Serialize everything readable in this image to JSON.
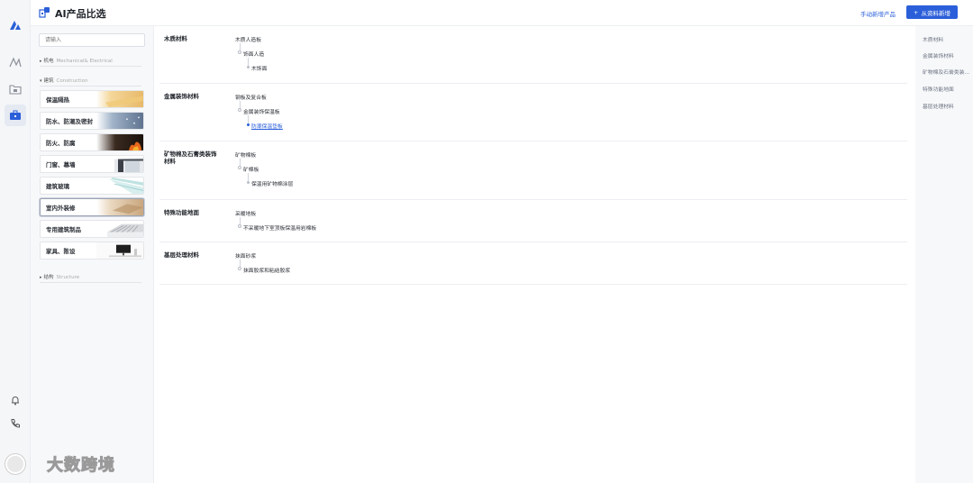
{
  "app": {
    "title": "AI产品比选"
  },
  "toolbar": {
    "manual_add": "手动新增产品",
    "add_from_data": "从资料新增",
    "add_plus": "+"
  },
  "rail": {
    "icons": [
      "logo-icon",
      "ai-icon",
      "folder-icon",
      "toolbox-icon",
      "bell-icon",
      "phone-icon"
    ]
  },
  "sidebar": {
    "search_placeholder": "请输入",
    "groups": [
      {
        "label": "机电",
        "en": "Mechanical& Electrical",
        "arrow": "▸"
      },
      {
        "label": "建筑",
        "en": "Construction",
        "arrow": "▾"
      },
      {
        "label": "结构",
        "en": "Structure",
        "arrow": "▸"
      }
    ],
    "cards": [
      {
        "label": "保温隔热"
      },
      {
        "label": "防水、防潮及密封"
      },
      {
        "label": "防火、防腐"
      },
      {
        "label": "门窗、幕墙"
      },
      {
        "label": "建筑玻璃"
      },
      {
        "label": "室内外装修",
        "active": true
      },
      {
        "label": "专用建筑制品"
      },
      {
        "label": "家具、陈设"
      }
    ]
  },
  "sections": [
    {
      "title": "木质材料",
      "l1": "木质人造板",
      "l2": [
        "饰面人造"
      ],
      "l3": [
        "木饰面"
      ]
    },
    {
      "title": "金属装饰材料",
      "l1": "钢板及复合板",
      "l2": [
        "金属装饰保温板"
      ],
      "l3": [
        "防潮保温垫板"
      ]
    },
    {
      "title": "矿物棉及石膏类装饰材料",
      "l1": "矿物棉板",
      "l2": [
        "矿棉板"
      ],
      "l3": [
        "保温用矿物棉涂层"
      ]
    },
    {
      "title": "特殊功能地面",
      "l1": "采暖地板",
      "l2": [
        "不采暖地下室顶板保温用岩棉板"
      ]
    },
    {
      "title": "基层处理材料",
      "l1": "抹面砂浆",
      "l2": [
        "抹面胶浆和粘结胶浆"
      ]
    }
  ],
  "anchors": [
    "木质材料",
    "金属装饰材料",
    "矿物棉及石膏类装饰材料",
    "特殊功能地面",
    "基层处理材料"
  ],
  "watermark": {
    "text": "大数跨境"
  }
}
